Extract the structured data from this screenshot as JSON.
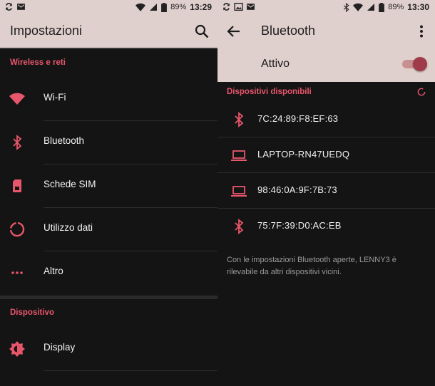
{
  "left": {
    "status": {
      "battery": "89%",
      "time": "13:29"
    },
    "title": "Impostazioni",
    "sections": [
      {
        "header": "Wireless e reti",
        "items": [
          {
            "label": "Wi-Fi",
            "icon": "wifi-icon"
          },
          {
            "label": "Bluetooth",
            "icon": "bluetooth-icon"
          },
          {
            "label": "Schede SIM",
            "icon": "sim-card-icon"
          },
          {
            "label": "Utilizzo dati",
            "icon": "data-usage-icon"
          },
          {
            "label": "Altro",
            "icon": "more-icon"
          }
        ]
      },
      {
        "header": "Dispositivo",
        "items": [
          {
            "label": "Display",
            "icon": "brightness-icon"
          }
        ]
      }
    ]
  },
  "right": {
    "status": {
      "battery": "89%",
      "time": "13:30"
    },
    "title": "Bluetooth",
    "toggle": {
      "label": "Attivo",
      "on": true
    },
    "devices_header": "Dispositivi disponibili",
    "devices": [
      {
        "label": "7C:24:89:F8:EF:63",
        "icon": "bluetooth-icon"
      },
      {
        "label": "LAPTOP-RN47UEDQ",
        "icon": "laptop-icon"
      },
      {
        "label": "98:46:0A:9F:7B:73",
        "icon": "laptop-icon"
      },
      {
        "label": "75:7F:39:D0:AC:EB",
        "icon": "bluetooth-icon"
      }
    ],
    "footnote": "Con le impostazioni Bluetooth aperte, LENNY3 è rilevabile da altri dispositivi vicini."
  },
  "colors": {
    "accent": "#e8566b",
    "appbar": "#e0d0cd",
    "background": "#141414",
    "switch_thumb": "#a03b4b"
  }
}
